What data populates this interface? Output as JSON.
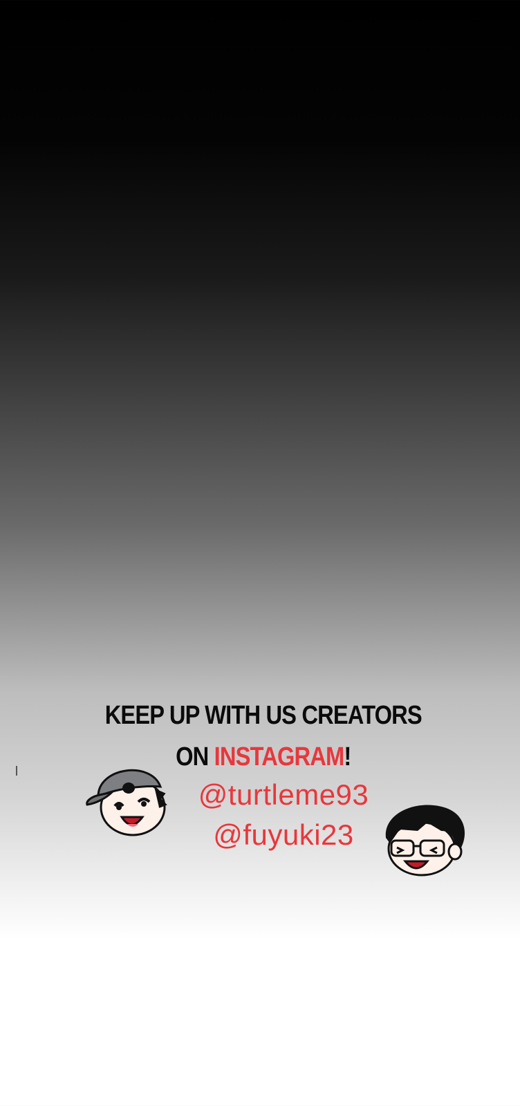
{
  "promo": {
    "headline_line1": "KEEP UP WITH US CREATORS",
    "headline_on": "ON ",
    "headline_accent": "INSTAGRAM",
    "headline_end": "!",
    "handles": [
      "@turtleme93",
      "@fuyuki23"
    ]
  },
  "colors": {
    "accent": "#e8373c",
    "text": "#0b0b0b"
  },
  "icons": {
    "left": "creator-cap-face-icon",
    "right": "creator-glasses-face-icon"
  }
}
